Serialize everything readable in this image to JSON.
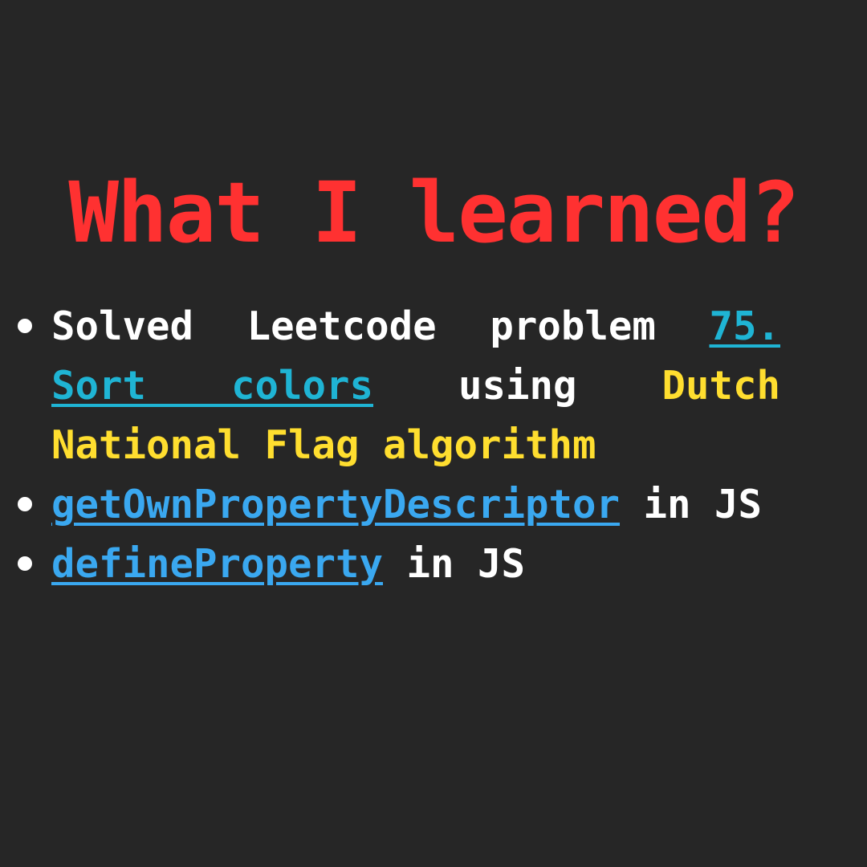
{
  "title": "What I learned?",
  "items": [
    {
      "prefix": "Solved Leetcode problem ",
      "link": "75. Sort colors",
      "middle": " using ",
      "highlight": "Dutch National Flag algorithm"
    },
    {
      "link": "getOwnPropertyDescriptor",
      "suffix": " in JS"
    },
    {
      "link": "defineProperty",
      "suffix": " in JS"
    }
  ],
  "colors": {
    "background": "#262626",
    "title": "#ff3131",
    "text": "#ffffff",
    "link_cyan": "#1fb4d4",
    "link_blue": "#3aa8f0",
    "highlight": "#ffde2f"
  }
}
